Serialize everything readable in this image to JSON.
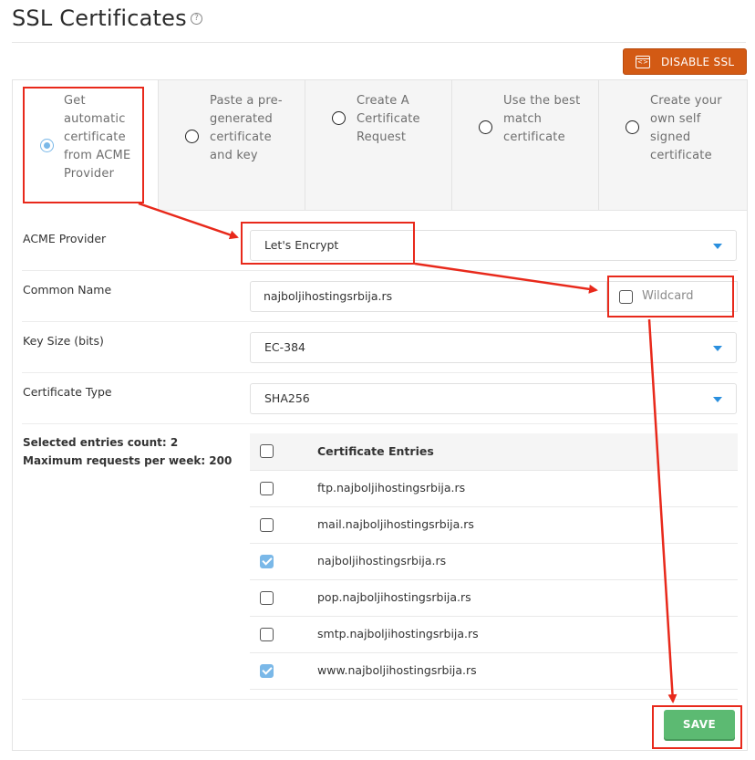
{
  "page": {
    "title": "SSL Certificates",
    "help_glyph": "?"
  },
  "toolbar": {
    "disable_ssl_label": "DISABLE SSL"
  },
  "tabs": [
    {
      "label": "Get automatic certificate from ACME Provider",
      "selected": true
    },
    {
      "label": "Paste a pre-generated certificate and key",
      "selected": false
    },
    {
      "label": "Create A Certificate Request",
      "selected": false
    },
    {
      "label": "Use the best match certificate",
      "selected": false
    },
    {
      "label": "Create your own self signed certificate",
      "selected": false
    }
  ],
  "form": {
    "acme_provider": {
      "label": "ACME Provider",
      "value": "Let's Encrypt"
    },
    "common_name": {
      "label": "Common Name",
      "value": "najboljihostingsrbija.rs",
      "wildcard_label": "Wildcard",
      "wildcard_checked": false
    },
    "key_size": {
      "label": "Key Size (bits)",
      "value": "EC-384"
    },
    "certificate_type": {
      "label": "Certificate Type",
      "value": "SHA256"
    }
  },
  "info": {
    "selected_count": "Selected entries count: 2",
    "max_requests": "Maximum requests per week: 200"
  },
  "entries": {
    "header": "Certificate Entries",
    "rows": [
      {
        "name": "ftp.najboljihostingsrbija.rs",
        "checked": false
      },
      {
        "name": "mail.najboljihostingsrbija.rs",
        "checked": false
      },
      {
        "name": "najboljihostingsrbija.rs",
        "checked": true
      },
      {
        "name": "pop.najboljihostingsrbija.rs",
        "checked": false
      },
      {
        "name": "smtp.najboljihostingsrbija.rs",
        "checked": false
      },
      {
        "name": "www.najboljihostingsrbija.rs",
        "checked": true
      }
    ]
  },
  "actions": {
    "save_label": "SAVE"
  },
  "colors": {
    "disable_ssl_bg": "#d35a14",
    "save_bg": "#5cba72",
    "accent_blue": "#7ab8e8",
    "annotation_red": "#e8291b"
  }
}
